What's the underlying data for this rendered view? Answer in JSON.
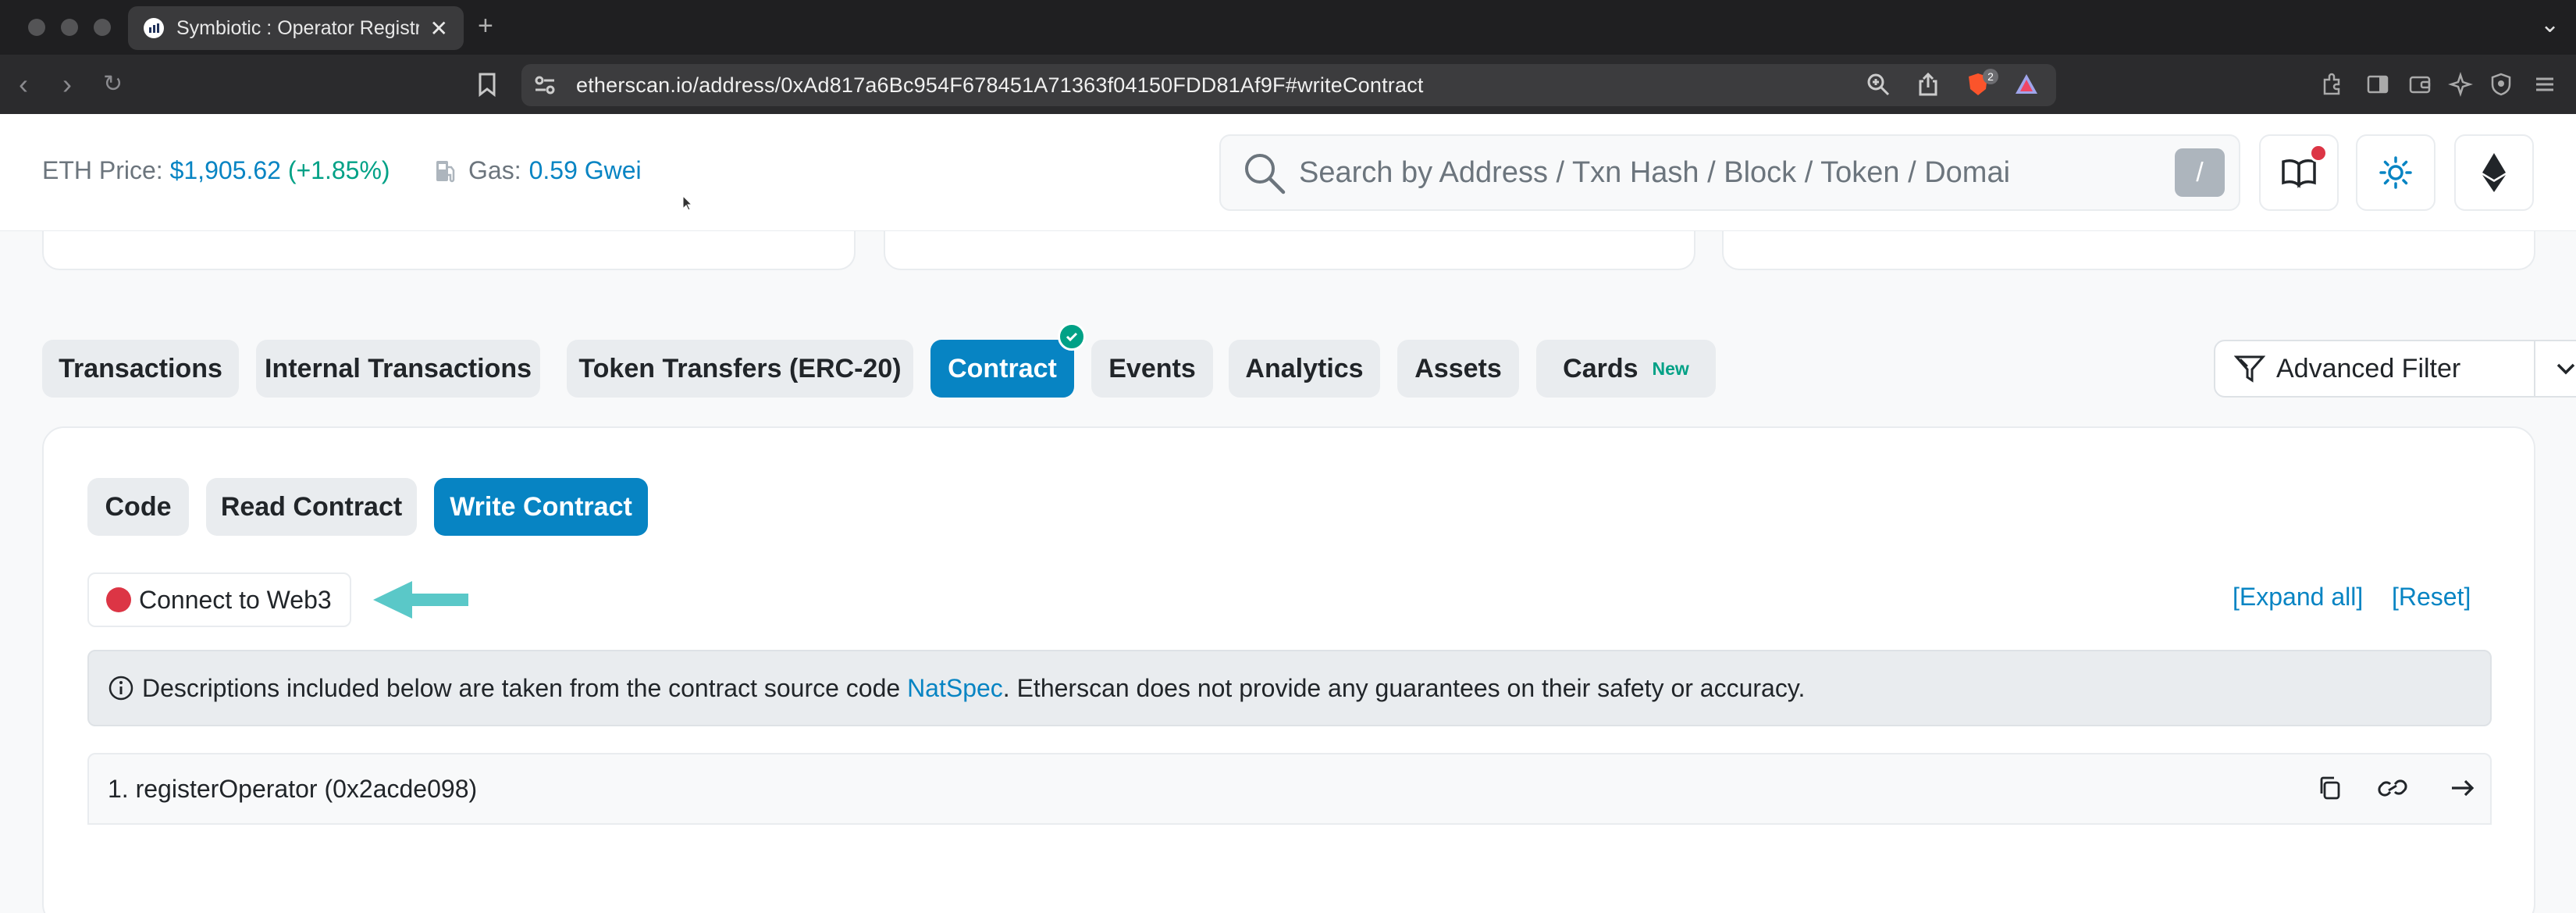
{
  "browser": {
    "tab_title": "Symbiotic : Operator Registry",
    "url": "etherscan.io/address/0xAd817a6Bc954F678451A71363f04150FDD81Af9F#writeContract",
    "extension_badge": "2"
  },
  "header": {
    "eth_price_label": "ETH Price:",
    "eth_price_value": "$1,905.62",
    "eth_price_change": "(+1.85%)",
    "gas_label": "Gas:",
    "gas_value": "0.59 Gwei",
    "search_placeholder": "Search by Address / Txn Hash / Block / Token / Domai",
    "search_shortcut": "/"
  },
  "tabs": [
    {
      "label": "Transactions"
    },
    {
      "label": "Internal Transactions"
    },
    {
      "label": "Token Transfers (ERC-20)"
    },
    {
      "label": "Contract"
    },
    {
      "label": "Events"
    },
    {
      "label": "Analytics"
    },
    {
      "label": "Assets"
    },
    {
      "label": "Cards",
      "badge": "New"
    }
  ],
  "advanced_filter_label": "Advanced Filter",
  "subtabs": [
    {
      "label": "Code"
    },
    {
      "label": "Read Contract"
    },
    {
      "label": "Write Contract"
    }
  ],
  "connect_label": "Connect to Web3",
  "expand_all_label": "[Expand all]",
  "reset_label": "[Reset]",
  "notice": {
    "prefix": "Descriptions included below are taken from the contract source code",
    "link": "NatSpec",
    "suffix": ". Etherscan does not provide any guarantees on their safety or accuracy."
  },
  "functions": [
    {
      "label": "1. registerOperator (0x2acde098)"
    }
  ],
  "colors": {
    "accent": "#0784c3",
    "success": "#00a186",
    "danger": "#dc3545",
    "arrow": "#5ac8c8"
  }
}
